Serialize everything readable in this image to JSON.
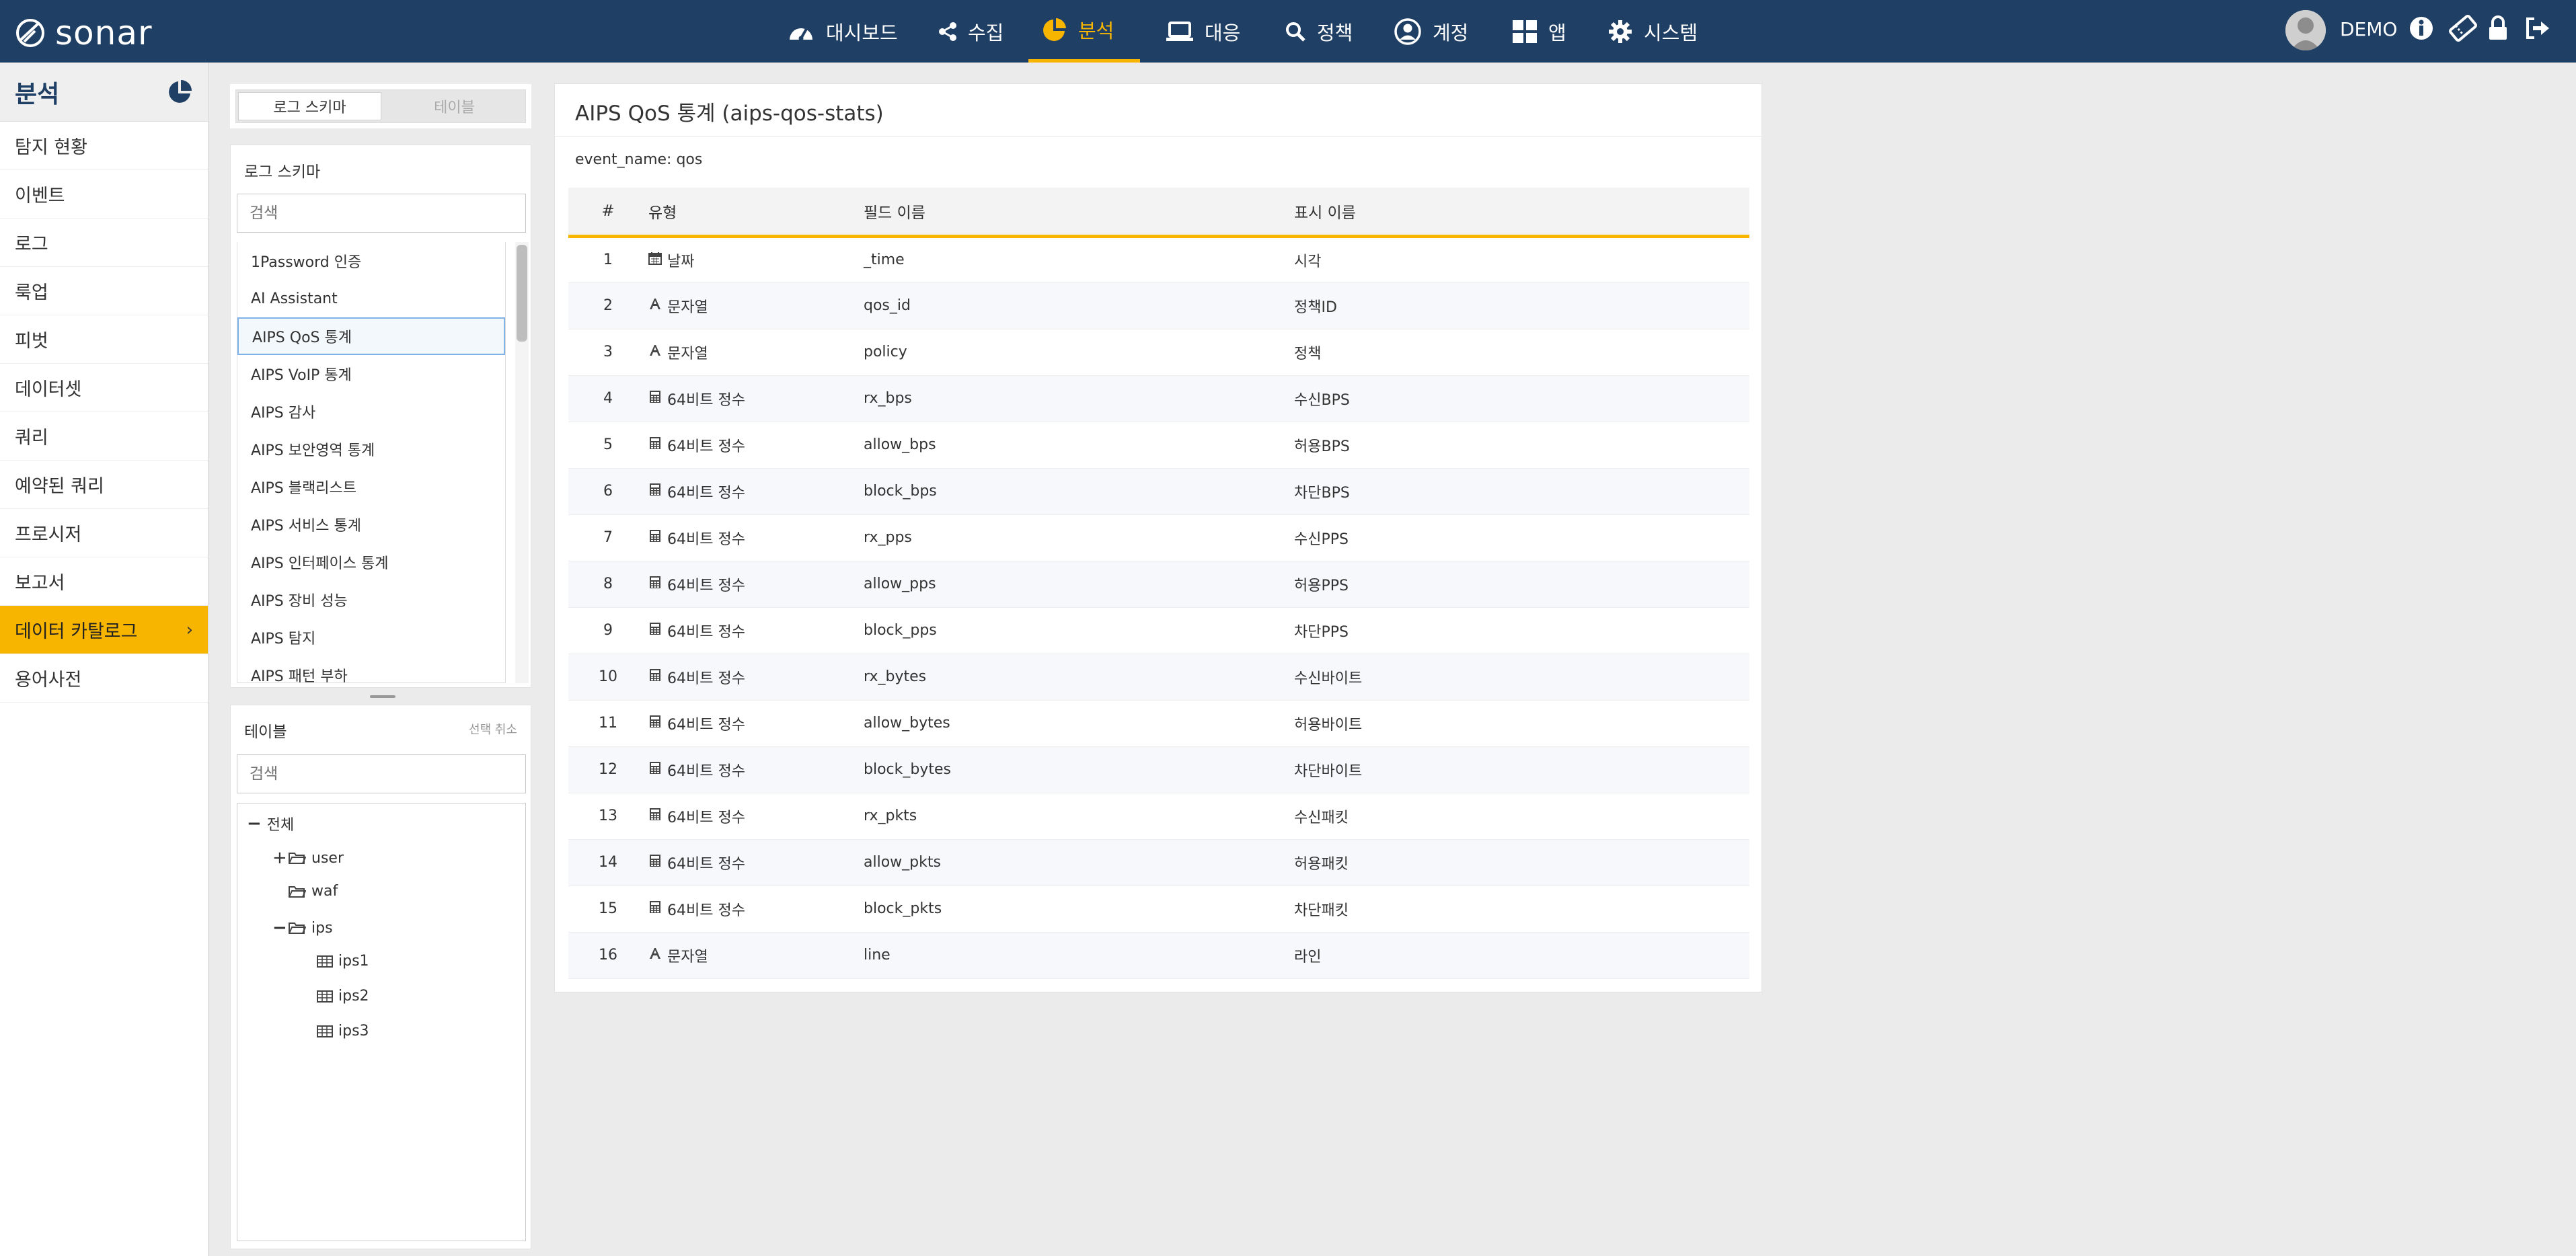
{
  "app": {
    "name": "sonar"
  },
  "nav": {
    "items": [
      {
        "label": "대시보드",
        "icon": "dashboard-icon",
        "active": false
      },
      {
        "label": "수집",
        "icon": "share-icon",
        "active": false
      },
      {
        "label": "분석",
        "icon": "pie-chart-icon",
        "active": true
      },
      {
        "label": "대응",
        "icon": "laptop-icon",
        "active": false
      },
      {
        "label": "정책",
        "icon": "search-icon",
        "active": false
      },
      {
        "label": "계정",
        "icon": "user-circle-icon",
        "active": false
      },
      {
        "label": "앱",
        "icon": "apps-grid-icon",
        "active": false
      },
      {
        "label": "시스템",
        "icon": "gear-icon",
        "active": false
      }
    ],
    "user": "DEMO",
    "accent": "#f7b500",
    "background": "#1f3f64"
  },
  "sidebar": {
    "title": "분석",
    "items": [
      {
        "label": "탐지 현황"
      },
      {
        "label": "이벤트"
      },
      {
        "label": "로그"
      },
      {
        "label": "룩업"
      },
      {
        "label": "피벗"
      },
      {
        "label": "데이터셋"
      },
      {
        "label": "쿼리"
      },
      {
        "label": "예약된 쿼리"
      },
      {
        "label": "프로시저"
      },
      {
        "label": "보고서"
      },
      {
        "label": "데이터 카탈로그",
        "active": true
      },
      {
        "label": "용어사전"
      }
    ]
  },
  "schema_panel": {
    "toggle": {
      "schema_label": "로그 스키마",
      "table_label": "테이블"
    },
    "heading": "로그 스키마",
    "search_placeholder": "검색",
    "items": [
      "1Password 인증",
      "AI Assistant",
      "AIPS QoS 통계",
      "AIPS VoIP 통계",
      "AIPS 감사",
      "AIPS 보안영역 통계",
      "AIPS 블랙리스트",
      "AIPS 서비스 통계",
      "AIPS 인터페이스 통계",
      "AIPS 장비 성능",
      "AIPS 탐지",
      "AIPS 패턴 부하"
    ],
    "selected_index": 2
  },
  "table_panel": {
    "heading": "테이블",
    "deselect_label": "선택 취소",
    "search_placeholder": "검색",
    "tree": {
      "root": "전체",
      "nodes": [
        {
          "label": "user",
          "expander": "+"
        },
        {
          "label": "waf",
          "expander": ""
        },
        {
          "label": "ips",
          "expander": "−"
        }
      ],
      "ips_children": [
        "ips1",
        "ips2",
        "ips3"
      ]
    }
  },
  "main": {
    "title": "AIPS QoS 통계 (aips-qos-stats)",
    "event_name": "event_name: qos",
    "columns": [
      "#",
      "유형",
      "필드 이름",
      "표시 이름"
    ],
    "rows": [
      {
        "num": "1",
        "type": "날짜",
        "type_icon": "calendar-icon",
        "field": "_time",
        "display": "시각"
      },
      {
        "num": "2",
        "type": "문자열",
        "type_icon": "text-icon",
        "field": "qos_id",
        "display": "정책ID"
      },
      {
        "num": "3",
        "type": "문자열",
        "type_icon": "text-icon",
        "field": "policy",
        "display": "정책"
      },
      {
        "num": "4",
        "type": "64비트 정수",
        "type_icon": "calculator-icon",
        "field": "rx_bps",
        "display": "수신BPS"
      },
      {
        "num": "5",
        "type": "64비트 정수",
        "type_icon": "calculator-icon",
        "field": "allow_bps",
        "display": "허용BPS"
      },
      {
        "num": "6",
        "type": "64비트 정수",
        "type_icon": "calculator-icon",
        "field": "block_bps",
        "display": "차단BPS"
      },
      {
        "num": "7",
        "type": "64비트 정수",
        "type_icon": "calculator-icon",
        "field": "rx_pps",
        "display": "수신PPS"
      },
      {
        "num": "8",
        "type": "64비트 정수",
        "type_icon": "calculator-icon",
        "field": "allow_pps",
        "display": "허용PPS"
      },
      {
        "num": "9",
        "type": "64비트 정수",
        "type_icon": "calculator-icon",
        "field": "block_pps",
        "display": "차단PPS"
      },
      {
        "num": "10",
        "type": "64비트 정수",
        "type_icon": "calculator-icon",
        "field": "rx_bytes",
        "display": "수신바이트"
      },
      {
        "num": "11",
        "type": "64비트 정수",
        "type_icon": "calculator-icon",
        "field": "allow_bytes",
        "display": "허용바이트"
      },
      {
        "num": "12",
        "type": "64비트 정수",
        "type_icon": "calculator-icon",
        "field": "block_bytes",
        "display": "차단바이트"
      },
      {
        "num": "13",
        "type": "64비트 정수",
        "type_icon": "calculator-icon",
        "field": "rx_pkts",
        "display": "수신패킷"
      },
      {
        "num": "14",
        "type": "64비트 정수",
        "type_icon": "calculator-icon",
        "field": "allow_pkts",
        "display": "허용패킷"
      },
      {
        "num": "15",
        "type": "64비트 정수",
        "type_icon": "calculator-icon",
        "field": "block_pkts",
        "display": "차단패킷"
      },
      {
        "num": "16",
        "type": "문자열",
        "type_icon": "text-icon",
        "field": "line",
        "display": "라인"
      }
    ]
  }
}
